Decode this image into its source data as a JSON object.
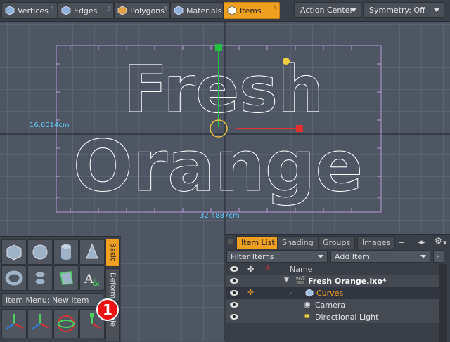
{
  "toolbar": {
    "tabs": [
      {
        "label": "Vertices",
        "number": "1",
        "icon": "vertices-cube-icon"
      },
      {
        "label": "Edges",
        "number": "2",
        "icon": "edges-cube-icon"
      },
      {
        "label": "Polygons",
        "number": "3",
        "icon": "polygons-cube-icon"
      },
      {
        "label": "Materials",
        "number": "",
        "icon": "materials-cube-icon"
      },
      {
        "label": "Items",
        "number": "5",
        "icon": "items-cube-icon",
        "active": true
      }
    ],
    "action_center": "Action Center",
    "symmetry": "Symmetry: Off"
  },
  "viewport": {
    "text_line1": "Fresh",
    "text_line2": "Orange",
    "height_dim": "16.6014cm",
    "width_dim": "32.4887cm"
  },
  "tool_palette": {
    "side_tabs": [
      "Basic",
      "Deform",
      "Scale"
    ],
    "item_menu": "Item Menu: New Item",
    "badge": "1"
  },
  "item_panel": {
    "tabs": [
      "Item List",
      "Shading",
      "Groups",
      "Images",
      "+"
    ],
    "filter": "Filter Items",
    "add_item": "Add Item",
    "f_button": "F",
    "column_name": "Name",
    "items": [
      {
        "name": "Fresh Orange.lxo*",
        "icon": "scene-clapper-icon"
      },
      {
        "name": "Curves",
        "icon": "mesh-cube-icon"
      },
      {
        "name": "Camera",
        "icon": "camera-icon"
      },
      {
        "name": "Directional Light",
        "icon": "light-icon"
      }
    ]
  },
  "colors": {
    "accent": "#f0a020",
    "dimension": "#5fd0ff",
    "x_axis": "#e03030",
    "y_axis": "#20c040"
  }
}
